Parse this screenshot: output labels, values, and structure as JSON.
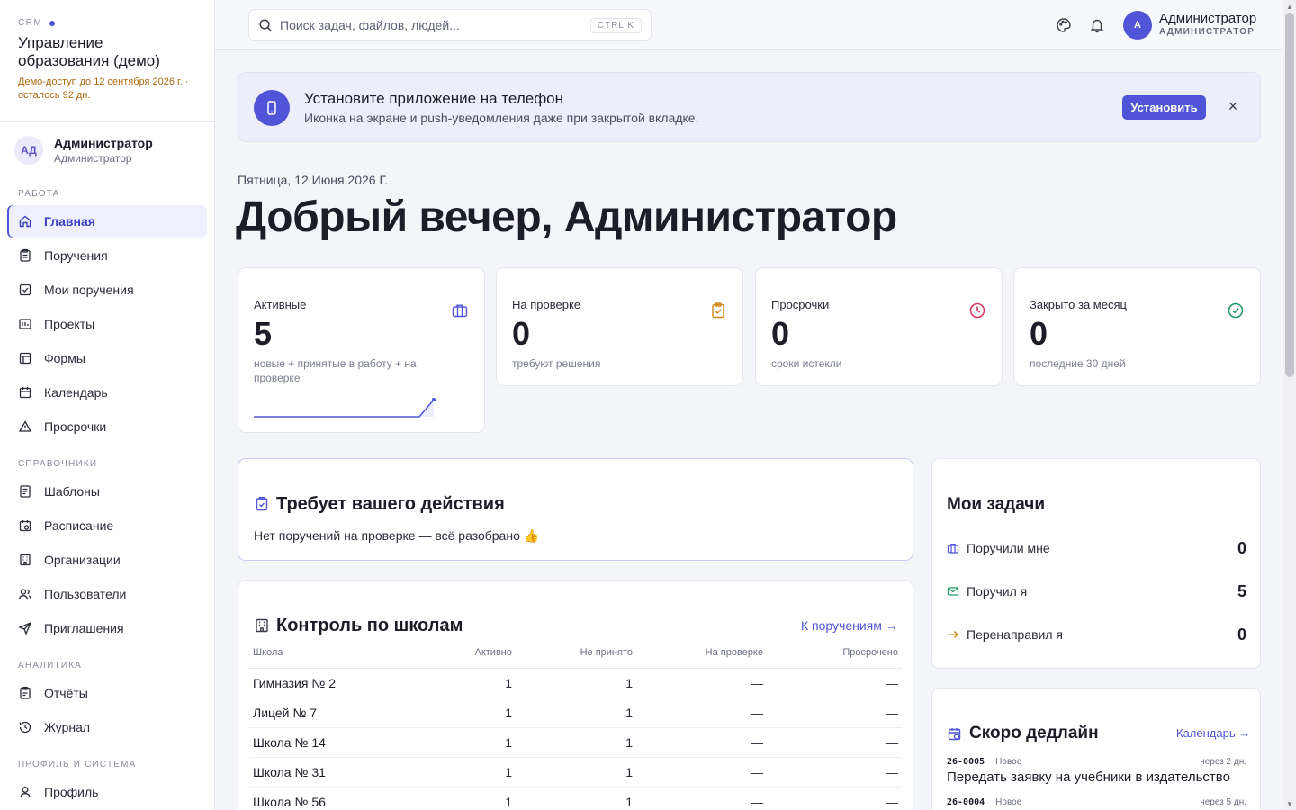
{
  "brand": {
    "tag": "CRM",
    "title": "Управление образования (демо)",
    "demo_note": "Демо-доступ до 12 сентября 2026 г. · осталось 92 дн."
  },
  "sidebar_user": {
    "initials": "АД",
    "name": "Администратор",
    "role": "Администратор"
  },
  "nav": {
    "work_label": "Работа",
    "work": [
      {
        "label": "Главная",
        "icon": "home-icon"
      },
      {
        "label": "Поручения",
        "icon": "clipboard-icon"
      },
      {
        "label": "Мои поручения",
        "icon": "checkbox-icon"
      },
      {
        "label": "Проекты",
        "icon": "projects-icon"
      },
      {
        "label": "Формы",
        "icon": "forms-icon"
      },
      {
        "label": "Календарь",
        "icon": "calendar-icon"
      },
      {
        "label": "Просрочки",
        "icon": "warning-icon"
      }
    ],
    "refs_label": "Справочники",
    "refs": [
      {
        "label": "Шаблоны",
        "icon": "template-icon"
      },
      {
        "label": "Расписание",
        "icon": "schedule-icon"
      },
      {
        "label": "Организации",
        "icon": "building-icon"
      },
      {
        "label": "Пользователи",
        "icon": "users-icon"
      },
      {
        "label": "Приглашения",
        "icon": "send-icon"
      }
    ],
    "analytics_label": "Аналитика",
    "analytics": [
      {
        "label": "Отчёты",
        "icon": "report-icon"
      },
      {
        "label": "Журнал",
        "icon": "history-icon"
      }
    ],
    "system_label": "Профиль и система",
    "system": [
      {
        "label": "Профиль",
        "icon": "user-icon"
      }
    ]
  },
  "topbar": {
    "search_placeholder": "Поиск задач, файлов, людей...",
    "shortcut": "CTRL K",
    "avatar_initial": "A",
    "user_name": "Администратор",
    "user_role": "АДМИНИСТРАТОР"
  },
  "banner": {
    "title": "Установите приложение на телефон",
    "subtitle": "Иконка на экране и push-уведомления даже при закрытой вкладке.",
    "install_label": "Установить",
    "close_label": "×"
  },
  "date": "Пятница, 12 Июня 2026 Г.",
  "greeting": "Добрый вечер, Администратор",
  "stats": [
    {
      "label": "Активные",
      "value": "5",
      "sub": "новые + принятые в работу + на проверке",
      "icon": "briefcase-icon",
      "color": "#4f55d6"
    },
    {
      "label": "На проверке",
      "value": "0",
      "sub": "требуют решения",
      "icon": "clipboard-check-icon",
      "color": "#d08a16"
    },
    {
      "label": "Просрочки",
      "value": "0",
      "sub": "сроки истекли",
      "icon": "clock-icon",
      "color": "#d8345a"
    },
    {
      "label": "Закрыто за месяц",
      "value": "0",
      "sub": "последние 30 дней",
      "icon": "check-circle-icon",
      "color": "#1a9a63"
    }
  ],
  "action_card": {
    "title": "Требует вашего действия",
    "text": "Нет поручений на проверке — всё разобрано 👍"
  },
  "schools": {
    "title": "Контроль по школам",
    "link": "К поручениям →",
    "columns": [
      "Школа",
      "Активно",
      "Не принято",
      "На проверке",
      "Просрочено"
    ],
    "rows": [
      [
        "Гимназия № 2",
        "1",
        "1",
        "—",
        "—"
      ],
      [
        "Лицей № 7",
        "1",
        "1",
        "—",
        "—"
      ],
      [
        "Школа № 14",
        "1",
        "1",
        "—",
        "—"
      ],
      [
        "Школа № 31",
        "1",
        "1",
        "—",
        "—"
      ],
      [
        "Школа № 56",
        "1",
        "1",
        "—",
        "—"
      ]
    ]
  },
  "my_tasks": {
    "title": "Мои задачи",
    "items": [
      {
        "label": "Поручили мне",
        "count": "0",
        "icon": "briefcase-icon"
      },
      {
        "label": "Поручил я",
        "count": "5",
        "icon": "mail-icon"
      },
      {
        "label": "Перенаправил я",
        "count": "0",
        "icon": "arrow-right-icon"
      }
    ]
  },
  "deadlines": {
    "title": "Скоро дедлайн",
    "link": "Календарь →",
    "items": [
      {
        "id": "26-0005",
        "status": "Новое",
        "due": "через 2 дн.",
        "title": "Передать заявку на учебники в издательство"
      },
      {
        "id": "26-0004",
        "status": "Новое",
        "due": "через 5 дн.",
        "title": ""
      }
    ]
  },
  "colors": {
    "accent": "#4f55d6",
    "warning": "#b06a12"
  }
}
